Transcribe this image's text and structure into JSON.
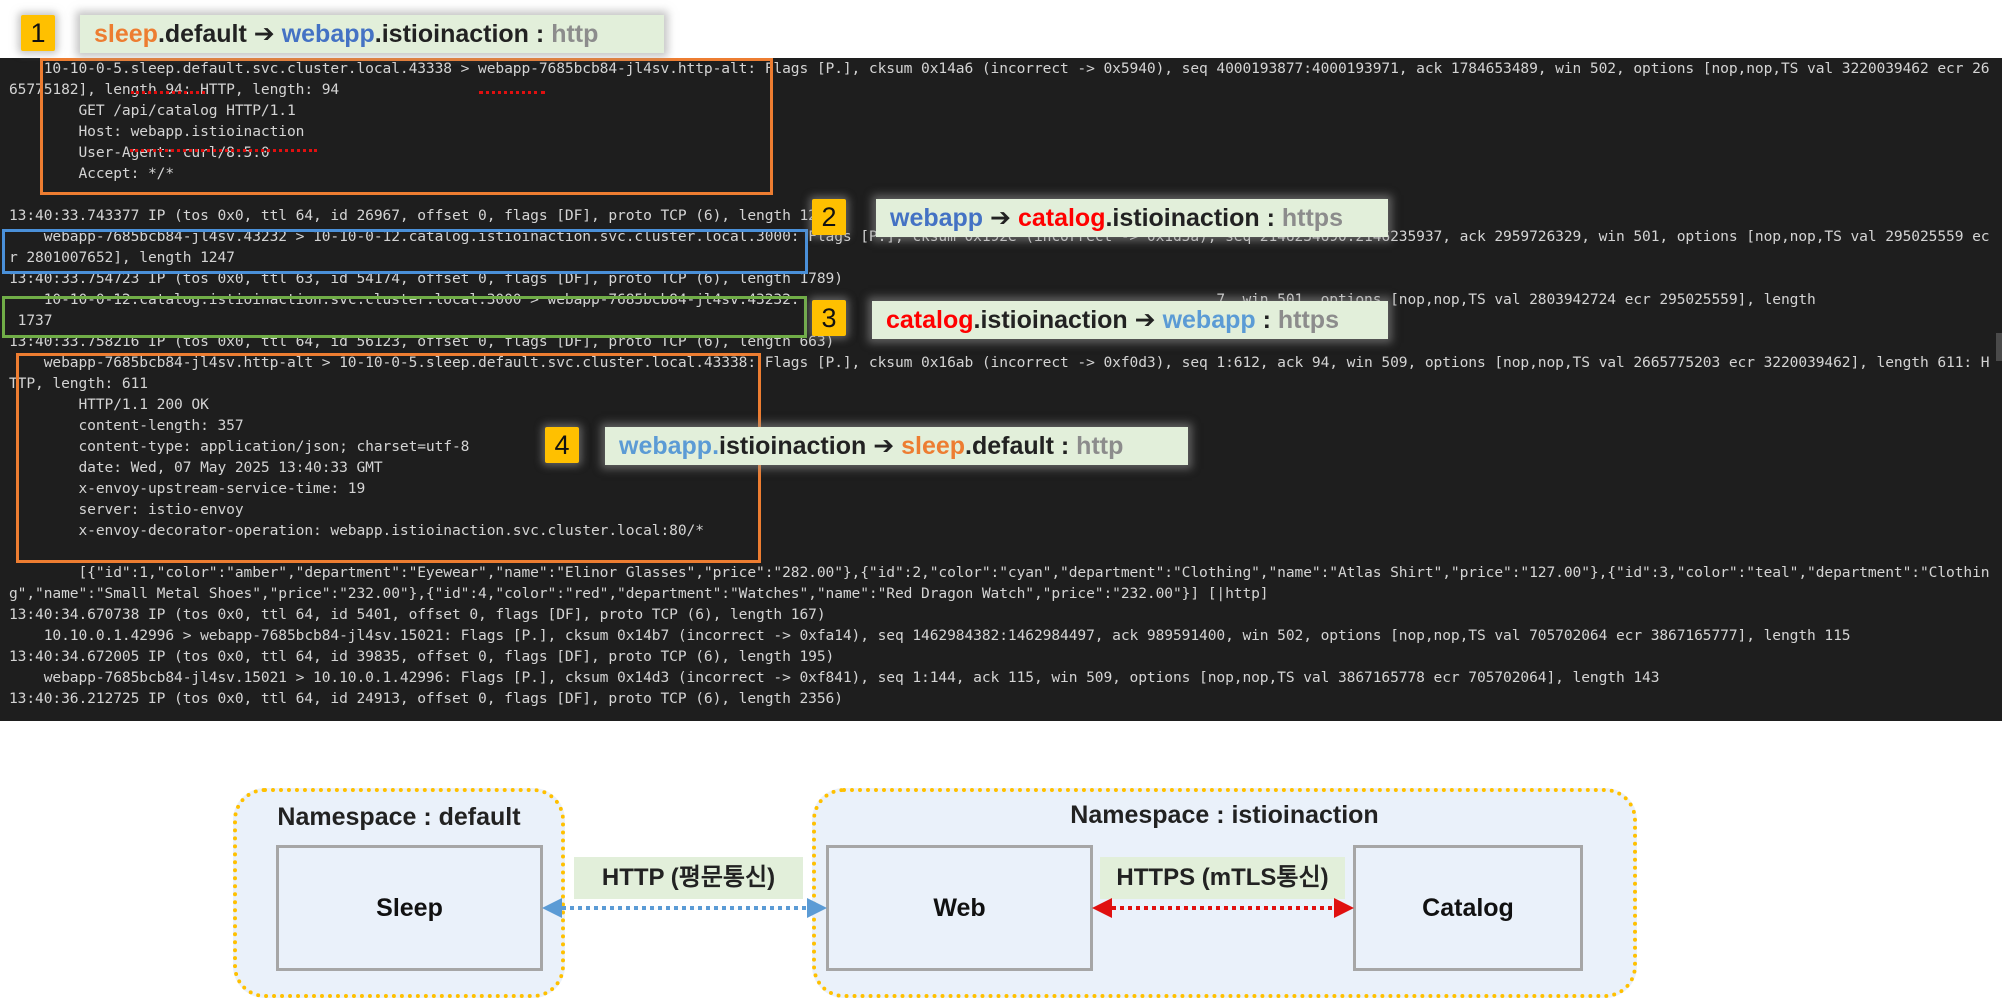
{
  "terminal_lines": [
    "    10-10-0-5.sleep.default.svc.cluster.local.43338 > webapp-7685bcb84-jl4sv.http-alt: Flags [P.], cksum 0x14a6 (incorrect -> 0x5940), seq 4000193877:4000193971, ack 1784653489, win 502, options [nop,nop,TS val 3220039462 ecr 26",
    "65775182], length 94: HTTP, length: 94",
    "        GET /api/catalog HTTP/1.1",
    "        Host: webapp.istioinaction",
    "        User-Agent: curl/8.5.0",
    "        Accept: */*",
    "",
    "13:40:33.743377 IP (tos 0x0, ttl 64, id 26967, offset 0, flags [DF], proto TCP (6), length 12",
    "    webapp-7685bcb84-jl4sv.43232 > 10-10-0-12.catalog.istioinaction.svc.cluster.local.3000: Flags [P.], cksum 0x192e (incorrect -> 0x1d5a), seq 2146234690:2146235937, ack 2959726329, win 501, options [nop,nop,TS val 295025559 ec",
    "r 2801007652], length 1247",
    "13:40:33.754723 IP (tos 0x0, ttl 63, id 54174, offset 0, flags [DF], proto TCP (6), length 1789)",
    "    10-10-0-12.catalog.istioinaction.svc.cluster.local.3000 > webapp-7685bcb84-jl4sv.43232:                                                7, win 501, options [nop,nop,TS val 2803942724 ecr 295025559], length",
    " 1737",
    "13:40:33.758216 IP (tos 0x0, ttl 64, id 56123, offset 0, flags [DF], proto TCP (6), length 663)",
    "    webapp-7685bcb84-jl4sv.http-alt > 10-10-0-5.sleep.default.svc.cluster.local.43338: Flags [P.], cksum 0x16ab (incorrect -> 0xf0d3), seq 1:612, ack 94, win 509, options [nop,nop,TS val 2665775203 ecr 3220039462], length 611: H",
    "TTP, length: 611",
    "        HTTP/1.1 200 OK",
    "        content-length: 357",
    "        content-type: application/json; charset=utf-8",
    "        date: Wed, 07 May 2025 13:40:33 GMT",
    "        x-envoy-upstream-service-time: 19",
    "        server: istio-envoy",
    "        x-envoy-decorator-operation: webapp.istioinaction.svc.cluster.local:80/*",
    "",
    "        [{\"id\":1,\"color\":\"amber\",\"department\":\"Eyewear\",\"name\":\"Elinor Glasses\",\"price\":\"282.00\"},{\"id\":2,\"color\":\"cyan\",\"department\":\"Clothing\",\"name\":\"Atlas Shirt\",\"price\":\"127.00\"},{\"id\":3,\"color\":\"teal\",\"department\":\"Clothin",
    "g\",\"name\":\"Small Metal Shoes\",\"price\":\"232.00\"},{\"id\":4,\"color\":\"red\",\"department\":\"Watches\",\"name\":\"Red Dragon Watch\",\"price\":\"232.00\"}] [|http]",
    "13:40:34.670738 IP (tos 0x0, ttl 64, id 5401, offset 0, flags [DF], proto TCP (6), length 167)",
    "    10.10.0.1.42996 > webapp-7685bcb84-jl4sv.15021: Flags [P.], cksum 0x14b7 (incorrect -> 0xfa14), seq 1462984382:1462984497, ack 989591400, win 502, options [nop,nop,TS val 705702064 ecr 3867165777], length 115",
    "13:40:34.672005 IP (tos 0x0, ttl 64, id 39835, offset 0, flags [DF], proto TCP (6), length 195)",
    "    webapp-7685bcb84-jl4sv.15021 > 10.10.0.1.42996: Flags [P.], cksum 0x14d3 (incorrect -> 0xf841), seq 1:144, ack 115, win 509, options [nop,nop,TS val 3867165778 ecr 705702064], length 143",
    "13:40:36.212725 IP (tos 0x0, ttl 64, id 24913, offset 0, flags [DF], proto TCP (6), length 2356)"
  ],
  "callouts": [
    {
      "num": "1",
      "from_a": "sleep",
      "from_b": ".default",
      "arrow": "➔",
      "to_a": "webapp",
      "to_b": ".istioinaction",
      "sep": " : ",
      "proto": "http"
    },
    {
      "num": "2",
      "from_a": "webapp",
      "from_b": "",
      "arrow": "➔",
      "to_a": "catalog",
      "to_b": ".istioinaction",
      "sep": " : ",
      "proto": "https"
    },
    {
      "num": "3",
      "from_a": "catalog",
      "from_b": ".istioinaction",
      "arrow": "➔",
      "to_a": "webapp",
      "to_b": "",
      "sep": " : ",
      "proto": "https"
    },
    {
      "num": "4",
      "from_a": "webapp.",
      "from_b": "istioinaction",
      "arrow": "➔",
      "to_a": "sleep",
      "to_b": ".default",
      "sep": " : ",
      "proto": "http"
    }
  ],
  "diagram": {
    "ns_default": "Namespace : default",
    "ns_istio": "Namespace : istioinaction",
    "svc_sleep": "Sleep",
    "svc_web": "Web",
    "svc_catalog": "Catalog",
    "label_http": "HTTP (평문통신)",
    "label_https": "HTTPS (mTLS통신)"
  },
  "colors": {
    "orange": "#ed7d31",
    "blue": "#4472c4",
    "light_blue": "#5b9bd5",
    "red": "#ff0000",
    "green_box": "#70ad47",
    "badge_yellow": "#ffc000",
    "terminal_bg": "#1e1e1e"
  }
}
